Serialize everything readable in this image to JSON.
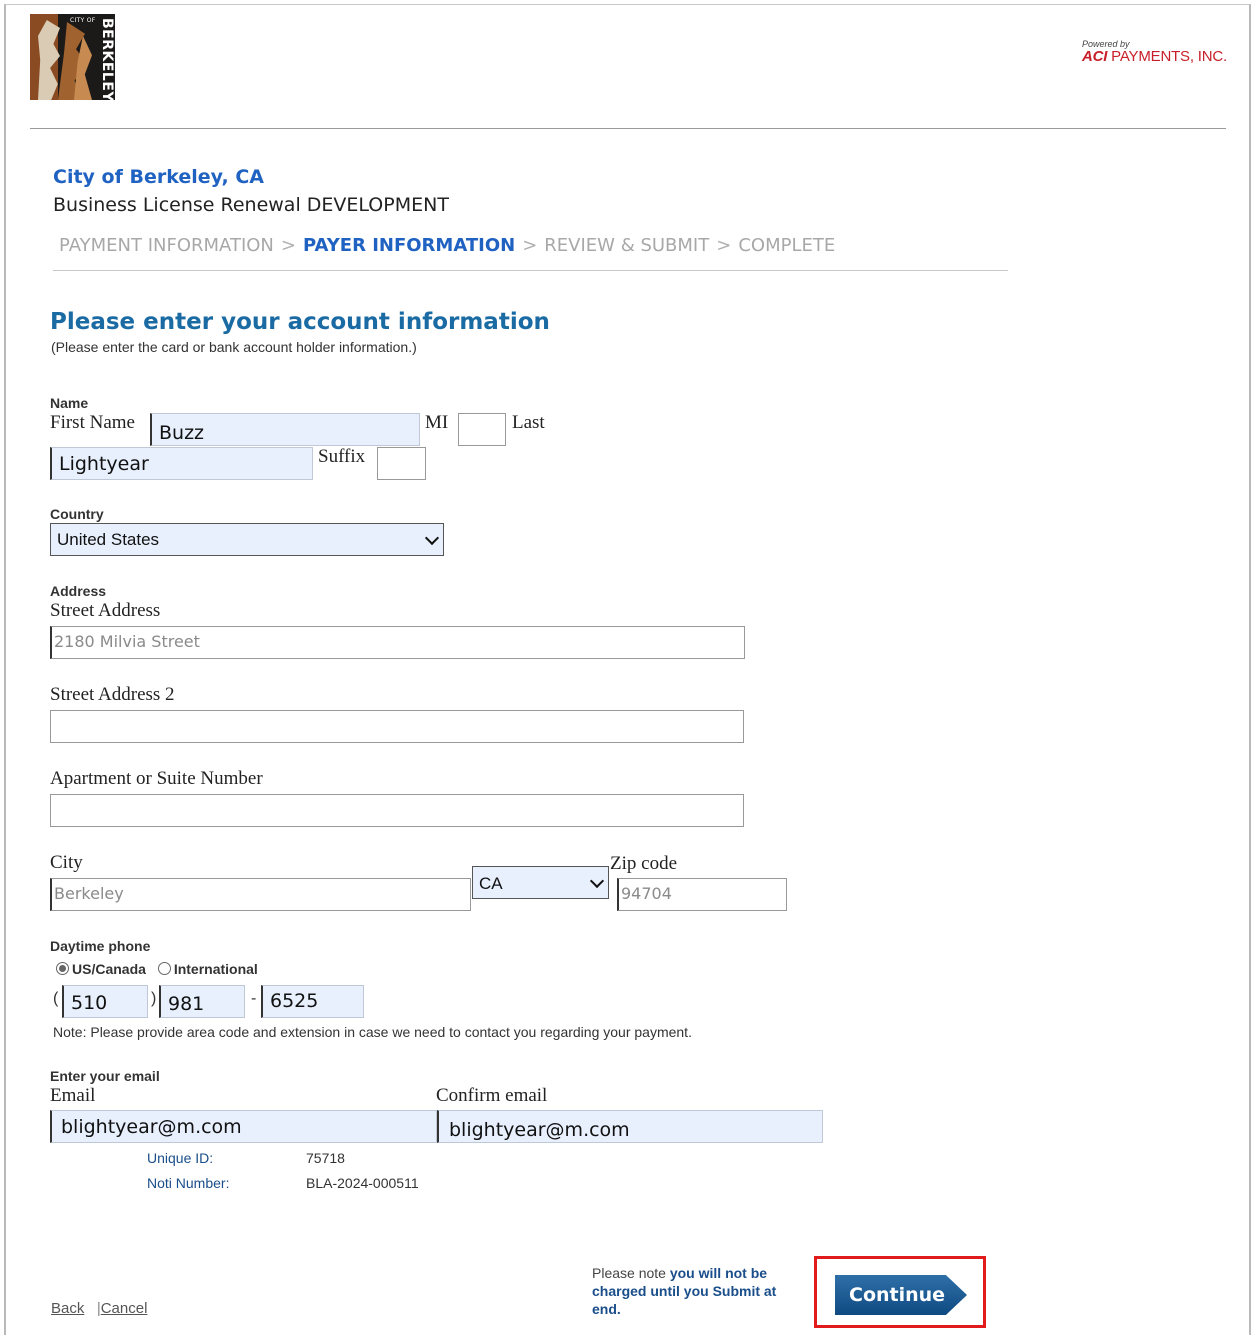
{
  "header": {
    "logo_text_small": "CITY OF",
    "logo_text": "BERKELEY",
    "powered_by": "Powered by",
    "aci_brand": "ACI",
    "aci_company": "PAYMENTS, INC."
  },
  "title": {
    "city": "City of Berkeley, CA",
    "subtitle": "Business License Renewal DEVELOPMENT"
  },
  "steps": [
    {
      "label": "PAYMENT INFORMATION",
      "active": false
    },
    {
      "label": "PAYER INFORMATION",
      "active": true
    },
    {
      "label": "REVIEW & SUBMIT",
      "active": false
    },
    {
      "label": "COMPLETE",
      "active": false
    }
  ],
  "step_separator": ">",
  "form": {
    "heading": "Please enter your account information",
    "hint": "(Please enter the card or bank account holder information.)",
    "name_section": "Name",
    "first_name_label": "First Name",
    "first_name": "Buzz",
    "mi_label": "MI",
    "mi": "",
    "last_label": "Last",
    "last_name": "Lightyear",
    "suffix_label": "Suffix",
    "suffix": "",
    "country_label": "Country",
    "country": "United States",
    "address_section": "Address",
    "street_label": "Street Address",
    "street_placeholder": "2180 Milvia Street",
    "street2_label": "Street Address 2",
    "apt_label": "Apartment or Suite Number",
    "city_label": "City",
    "city_placeholder": "Berkeley",
    "state": "CA",
    "zip_label": "Zip code",
    "zip_placeholder": "94704",
    "phone_section": "Daytime phone",
    "radio_us": "US/Canada",
    "radio_intl": "International",
    "phone_open": "(",
    "phone_close": ")",
    "phone_dash": "-",
    "area_code": "510",
    "prefix": "981",
    "line": "6525",
    "phone_note": "Note: Please provide area code and extension in case we need to contact you regarding your payment.",
    "email_section": "Enter your email",
    "email_label": "Email",
    "email": "blightyear@m.com",
    "confirm_label": "Confirm email",
    "confirm_email": "blightyear@m.com",
    "unique_id_label": "Unique ID:",
    "unique_id": "75718",
    "noti_label": "Noti Number:",
    "noti_number": "BLA-2024-000511"
  },
  "footer": {
    "back": "Back",
    "divider": "|",
    "cancel": "Cancel",
    "note_prefix": "Please note",
    "note_rest": " you will not be charged until you Submit at end.",
    "continue": "Continue"
  },
  "colors": {
    "link_blue": "#1f62c2",
    "heading_blue": "#1a6aa3",
    "highlight_red": "#e11b1b",
    "button_blue": "#0f4a82"
  }
}
